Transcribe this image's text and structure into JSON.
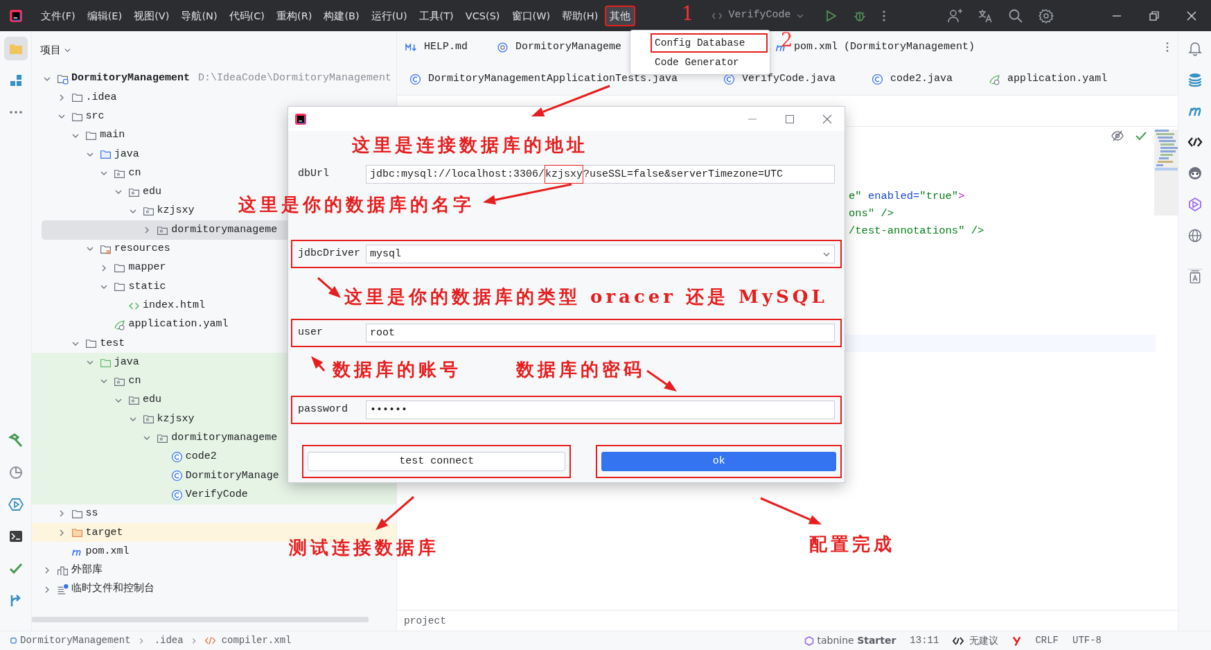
{
  "title_bar": {
    "menus": [
      {
        "label": "文件(F)",
        "selected": false,
        "annotated": false
      },
      {
        "label": "编辑(E)",
        "selected": false,
        "annotated": false
      },
      {
        "label": "视图(V)",
        "selected": false,
        "annotated": false
      },
      {
        "label": "导航(N)",
        "selected": false,
        "annotated": false
      },
      {
        "label": "代码(C)",
        "selected": false,
        "annotated": false
      },
      {
        "label": "重构(R)",
        "selected": false,
        "annotated": false
      },
      {
        "label": "构建(B)",
        "selected": false,
        "annotated": false
      },
      {
        "label": "运行(U)",
        "selected": false,
        "annotated": false
      },
      {
        "label": "工具(T)",
        "selected": false,
        "annotated": false
      },
      {
        "label": "VCS(S)",
        "selected": false,
        "annotated": false
      },
      {
        "label": "窗口(W)",
        "selected": false,
        "annotated": false
      },
      {
        "label": "帮助(H)",
        "selected": false,
        "annotated": false
      },
      {
        "label": "其他",
        "selected": true,
        "annotated": true
      }
    ],
    "run_config": "VerifyCode"
  },
  "dropdown": {
    "items": [
      {
        "label": "Config Database",
        "annotated": true
      },
      {
        "label": "Code Generator",
        "annotated": false
      }
    ]
  },
  "left_tools": [
    {
      "kind": "project",
      "selected": true
    },
    {
      "kind": "structure",
      "selected": false
    },
    {
      "kind": "more",
      "selected": false
    },
    {
      "kind": "build",
      "selected": false
    },
    {
      "kind": "profiler",
      "selected": false
    },
    {
      "kind": "services",
      "selected": false
    },
    {
      "kind": "terminal",
      "selected": false
    },
    {
      "kind": "problems",
      "selected": false
    },
    {
      "kind": "git",
      "selected": false
    }
  ],
  "project_panel": {
    "title": "项目",
    "tree": [
      {
        "label": "DormitoryManagement",
        "path": "D:\\IdeaCode\\DormitoryManagement",
        "kind": "module",
        "expanded": true,
        "selected": false,
        "children": [
          {
            "label": ".idea",
            "kind": "folder",
            "expanded": false,
            "selected": false
          },
          {
            "label": "src",
            "kind": "folder",
            "expanded": true,
            "selected": false,
            "children": [
              {
                "label": "main",
                "kind": "folder",
                "expanded": true,
                "selected": false,
                "children": [
                  {
                    "label": "java",
                    "kind": "source",
                    "expanded": true,
                    "selected": false,
                    "children": [
                      {
                        "label": "cn",
                        "kind": "package",
                        "expanded": true,
                        "selected": false,
                        "children": [
                          {
                            "label": "edu",
                            "kind": "package",
                            "expanded": true,
                            "selected": false,
                            "children": [
                              {
                                "label": "kzjsxy",
                                "kind": "package",
                                "expanded": true,
                                "selected": false,
                                "children": [
                                  {
                                    "label": "dormitorymanageme",
                                    "kind": "package",
                                    "expanded": false,
                                    "selected": true
                                  }
                                ]
                              }
                            ]
                          }
                        ]
                      }
                    ]
                  },
                  {
                    "label": "resources",
                    "kind": "resources",
                    "expanded": true,
                    "selected": false,
                    "children": [
                      {
                        "label": "mapper",
                        "kind": "folder",
                        "expanded": false,
                        "selected": false
                      },
                      {
                        "label": "static",
                        "kind": "folder",
                        "expanded": true,
                        "selected": false,
                        "children": [
                          {
                            "label": "index.html",
                            "kind": "html",
                            "selected": false
                          }
                        ]
                      },
                      {
                        "label": "application.yaml",
                        "kind": "yaml",
                        "selected": false
                      }
                    ]
                  }
                ]
              },
              {
                "label": "test",
                "kind": "folder",
                "expanded": true,
                "selected": false,
                "children": [
                  {
                    "label": "java",
                    "kind": "testsource",
                    "expanded": true,
                    "selected": false,
                    "color": "#e6f4e6",
                    "children": [
                      {
                        "label": "cn",
                        "kind": "package",
                        "expanded": true,
                        "selected": false,
                        "color": "#e6f4e6",
                        "children": [
                          {
                            "label": "edu",
                            "kind": "package",
                            "expanded": true,
                            "selected": false,
                            "color": "#e6f4e6",
                            "children": [
                              {
                                "label": "kzjsxy",
                                "kind": "package",
                                "expanded": true,
                                "selected": false,
                                "color": "#e6f4e6",
                                "children": [
                                  {
                                    "label": "dormitorymanageme",
                                    "kind": "package",
                                    "expanded": true,
                                    "selected": false,
                                    "color": "#e6f4e6",
                                    "children": [
                                      {
                                        "label": "code2",
                                        "kind": "class",
                                        "selected": false,
                                        "color": "#e6f4e6"
                                      },
                                      {
                                        "label": "DormitoryManage",
                                        "kind": "class",
                                        "selected": false,
                                        "color": "#e6f4e6"
                                      },
                                      {
                                        "label": "VerifyCode",
                                        "kind": "class",
                                        "selected": false,
                                        "color": "#e6f4e6"
                                      }
                                    ]
                                  }
                                ]
                              }
                            ]
                          }
                        ]
                      }
                    ]
                  }
                ]
              }
            ]
          },
          {
            "label": "ss",
            "kind": "folder",
            "expanded": false,
            "selected": false
          },
          {
            "label": "target",
            "kind": "excluded",
            "expanded": false,
            "selected": false,
            "color": "#fdf5dd"
          },
          {
            "label": "pom.xml",
            "kind": "maven",
            "selected": false
          }
        ]
      },
      {
        "label": "外部库",
        "kind": "library",
        "expanded": false,
        "selected": false
      },
      {
        "label": "临时文件和控制台",
        "kind": "scratch",
        "expanded": false,
        "selected": false
      }
    ]
  },
  "editor": {
    "tab_rows": [
      [
        {
          "label": "HELP.md",
          "kind": "markdown"
        },
        {
          "label": "DormitoryManageme",
          "kind": "spring"
        },
        {
          "label": "pom.xml (DormitoryManagement)",
          "kind": "maven"
        }
      ],
      [
        {
          "label": "DormitoryManagementApplicationTests.java",
          "kind": "class"
        },
        {
          "label": "VerifyCode.java",
          "kind": "class"
        },
        {
          "label": "code2.java",
          "kind": "class"
        },
        {
          "label": "application.yaml",
          "kind": "yaml"
        }
      ]
    ],
    "code_lines": [
      [
        {
          "text": "e\"",
          "kind": "string"
        },
        {
          "text": " enabled=",
          "kind": "attribute"
        },
        {
          "text": "\"true\"",
          "kind": "string"
        },
        {
          "text": ">",
          "kind": "tag"
        }
      ],
      [
        {
          "text": "ons\"",
          "kind": "string"
        },
        {
          "text": " />",
          "kind": "string"
        }
      ],
      [
        {
          "text": "/test-annotations\"",
          "kind": "string"
        },
        {
          "text": " />",
          "kind": "string"
        }
      ]
    ],
    "breadcrumb": "project"
  },
  "dialog": {
    "fields": [
      {
        "kind": "text",
        "label": "dbUrl",
        "annotated": false,
        "value_parts": [
          {
            "text": "jdbc:mysql://localhost:3306/",
            "annotated": false
          },
          {
            "text": "kzjsxy",
            "annotated": true
          },
          {
            "text": "?useSSL=false&serverTimezone=UTC",
            "annotated": false
          }
        ]
      },
      {
        "kind": "select",
        "label": "jdbcDriver",
        "annotated": true,
        "value": "mysql"
      },
      {
        "kind": "text",
        "label": "user",
        "annotated": true,
        "value": "root"
      },
      {
        "kind": "password",
        "label": "password",
        "annotated": true,
        "value": "••••••"
      }
    ],
    "buttons": [
      {
        "label": "test connect",
        "kind": "secondary",
        "annotated": true
      },
      {
        "label": "ok",
        "kind": "primary",
        "annotated": true
      }
    ]
  },
  "status_bar": {
    "path": [
      {
        "label": "DormitoryManagement",
        "kind": "module"
      },
      {
        "label": ".idea",
        "kind": "folder"
      },
      {
        "label": "compiler.xml",
        "kind": "xml"
      }
    ],
    "tabnine": "tabnine **Starter**",
    "position": "13:11",
    "ai": "无建议",
    "line_ending": "CRLF",
    "encoding": "UTF-8"
  },
  "annotations": [
    {
      "text": "1",
      "kind": "number"
    },
    {
      "text": "2",
      "kind": "number"
    },
    {
      "text": "这里是连接数据库的地址",
      "kind": "note"
    },
    {
      "text": "这里是你的数据库的名字",
      "kind": "note"
    },
    {
      "text": "这里是你的数据库的类型 oracer 还是 MySQL",
      "kind": "note"
    },
    {
      "text": "数据库的账号",
      "kind": "note"
    },
    {
      "text": "数据库的密码",
      "kind": "note"
    },
    {
      "text": "测试连接数据库",
      "kind": "note"
    },
    {
      "text": "配置完成",
      "kind": "note"
    }
  ]
}
